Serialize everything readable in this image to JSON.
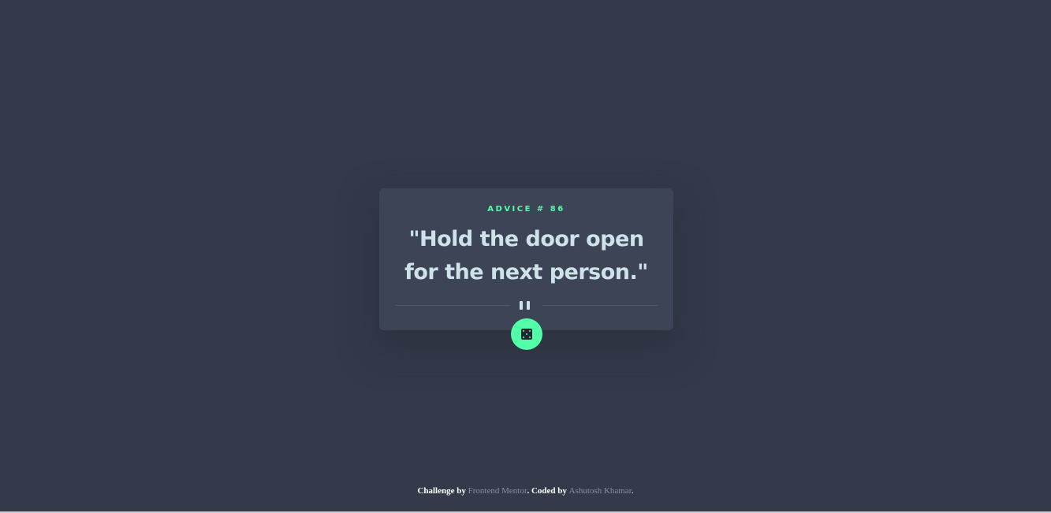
{
  "advice": {
    "id_label": "ADVICE # 86",
    "quote": "\"Hold the door open for the next person.\""
  },
  "controls": {
    "generate_button_icon": "dice-icon",
    "divider_icon": "pause-icon"
  },
  "footer": {
    "challenge_prefix": "Challenge by",
    "challenge_link": "Frontend Mentor",
    "coded_prefix": ". Coded by",
    "author_link": "Ashutosh Khamar",
    "suffix": "."
  },
  "colors": {
    "background": "#343a4a",
    "card": "#3d4456",
    "accent": "#52ffa8",
    "quote_text": "#cee3e9"
  }
}
